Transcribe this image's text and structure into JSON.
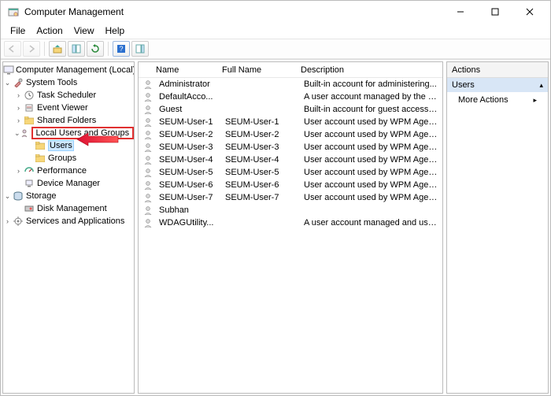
{
  "window": {
    "title": "Computer Management"
  },
  "menu": {
    "file": "File",
    "action": "Action",
    "view": "View",
    "help": "Help"
  },
  "tree": {
    "root": "Computer Management (Local)",
    "system_tools": "System Tools",
    "task_scheduler": "Task Scheduler",
    "event_viewer": "Event Viewer",
    "shared_folders": "Shared Folders",
    "local_users_groups": "Local Users and Groups",
    "users": "Users",
    "groups": "Groups",
    "performance": "Performance",
    "device_manager": "Device Manager",
    "storage": "Storage",
    "disk_management": "Disk Management",
    "services_apps": "Services and Applications"
  },
  "list": {
    "headers": {
      "name": "Name",
      "full": "Full Name",
      "desc": "Description"
    },
    "rows": [
      {
        "name": "Administrator",
        "full": "",
        "desc": "Built-in account for administering..."
      },
      {
        "name": "DefaultAcco...",
        "full": "",
        "desc": "A user account managed by the s..."
      },
      {
        "name": "Guest",
        "full": "",
        "desc": "Built-in account for guest access t..."
      },
      {
        "name": "SEUM-User-1",
        "full": "SEUM-User-1",
        "desc": "User account used by WPM Agen..."
      },
      {
        "name": "SEUM-User-2",
        "full": "SEUM-User-2",
        "desc": "User account used by WPM Agen..."
      },
      {
        "name": "SEUM-User-3",
        "full": "SEUM-User-3",
        "desc": "User account used by WPM Agen..."
      },
      {
        "name": "SEUM-User-4",
        "full": "SEUM-User-4",
        "desc": "User account used by WPM Agen..."
      },
      {
        "name": "SEUM-User-5",
        "full": "SEUM-User-5",
        "desc": "User account used by WPM Agen..."
      },
      {
        "name": "SEUM-User-6",
        "full": "SEUM-User-6",
        "desc": "User account used by WPM Agen..."
      },
      {
        "name": "SEUM-User-7",
        "full": "SEUM-User-7",
        "desc": "User account used by WPM Agen..."
      },
      {
        "name": "Subhan",
        "full": "",
        "desc": ""
      },
      {
        "name": "WDAGUtility...",
        "full": "",
        "desc": "A user account managed and use..."
      }
    ]
  },
  "actions": {
    "header": "Actions",
    "section": "Users",
    "more": "More Actions"
  }
}
